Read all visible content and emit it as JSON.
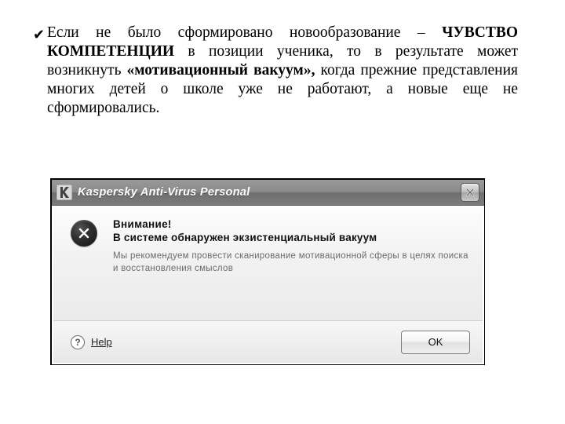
{
  "article": {
    "bullet_glyph": "✔",
    "para_run1": "Если не было сформировано новообразование – ",
    "para_bold1": "ЧУВСТВО КОМПЕТЕНЦИИ",
    "para_run2": " в позиции ученика, то в результате может возникнуть ",
    "para_bold2": "«мотивационный вакуум»,",
    "para_run3": " когда прежние представления многих детей о школе уже не работают, а новые еще не сформировались."
  },
  "dialog": {
    "title": "Kaspersky Anti-Virus Personal",
    "app_icon": "kaspersky-k-icon",
    "close_icon": "close-x",
    "attention_label": "Внимание!",
    "message": "В системе обнаружен экзистенциальный вакуум",
    "detail": "Мы рекомендуем провести сканирование мотивационной сферы в целях поиска и восстановления смыслов",
    "help_label": "Help",
    "help_glyph": "?",
    "ok_label": "OK"
  }
}
